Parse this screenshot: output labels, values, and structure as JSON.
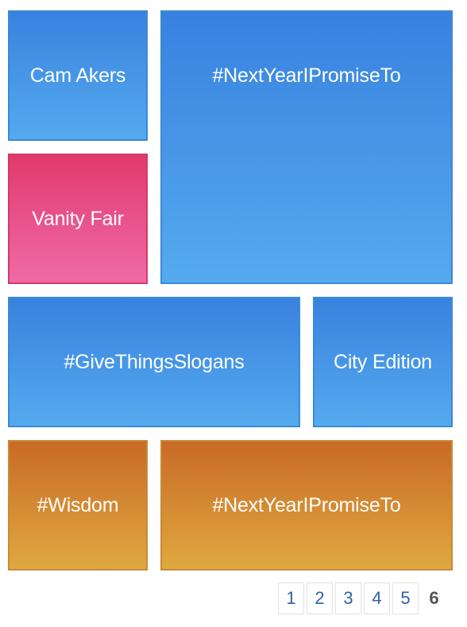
{
  "tiles": [
    {
      "label": "Cam Akers",
      "color": "blue"
    },
    {
      "label": "#NextYearIPromiseTo",
      "color": "blue"
    },
    {
      "label": "Vanity Fair",
      "color": "pink"
    },
    {
      "label": "#GiveThingsSlogans",
      "color": "blue"
    },
    {
      "label": "City Edition",
      "color": "blue"
    },
    {
      "label": "#Wisdom",
      "color": "orange"
    },
    {
      "label": "#NextYearIPromiseTo",
      "color": "orange"
    }
  ],
  "colors": {
    "blue_top": "#3882df",
    "blue_bottom": "#55aaee",
    "pink_top": "#e03a6c",
    "pink_bottom": "#f06aa8",
    "orange_top": "#c96a25",
    "orange_bottom": "#dfa940",
    "page_link": "#2f5fa8",
    "page_current": "#555555"
  },
  "pagination": {
    "pages": [
      "1",
      "2",
      "3",
      "4",
      "5"
    ],
    "current": "6"
  }
}
